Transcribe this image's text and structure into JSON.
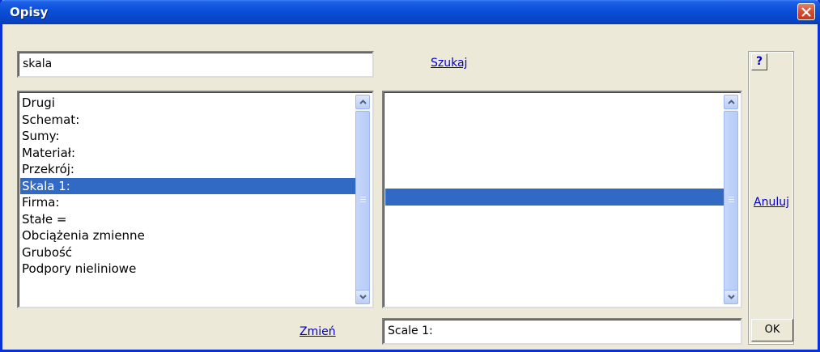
{
  "window": {
    "title": "Opisy"
  },
  "search": {
    "value": "skala",
    "button_label": "Szukaj"
  },
  "left_list": {
    "items": [
      "Drugi",
      "Schemat:",
      "Sumy:",
      "Materiał:",
      "Przekrój:",
      "Skala 1:",
      "Firma:",
      "Stałe =",
      "Obciążenia zmienne",
      "Grubość",
      "Podpory nieliniowe"
    ],
    "selected_index": 5
  },
  "actions": {
    "change_label": "Zmień",
    "cancel_label": "Anuluj",
    "help_label": "?",
    "ok_label": "OK"
  },
  "value_field": {
    "value": "Scale 1:"
  }
}
